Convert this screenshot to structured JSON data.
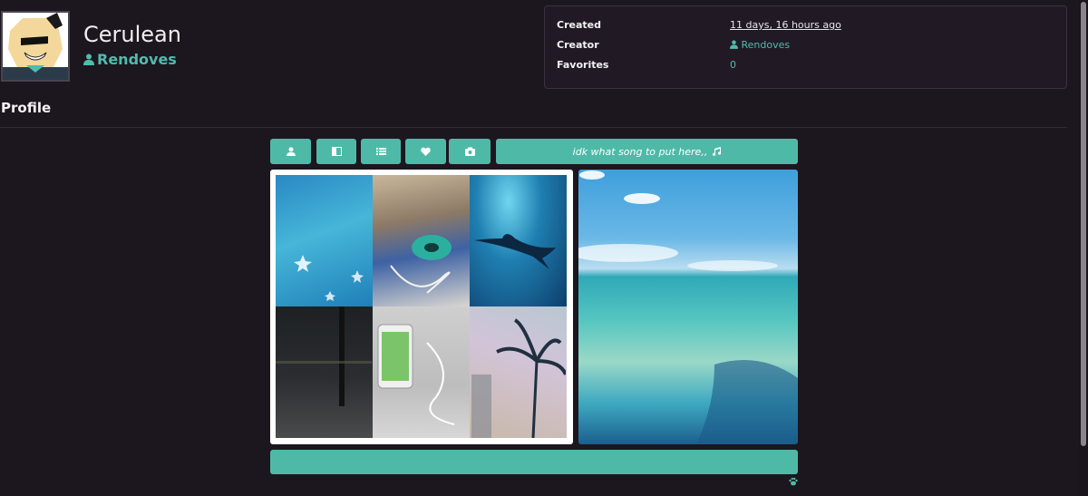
{
  "profile": {
    "name": "Cerulean",
    "creator": "Rendoves"
  },
  "info": [
    {
      "label": "Created",
      "value": "11 days, 16 hours ago"
    },
    {
      "label": "Creator",
      "value": "Rendoves"
    },
    {
      "label": "Favorites",
      "value": "0"
    }
  ],
  "section_title": "Profile",
  "tabs": {
    "icons": [
      "user-icon",
      "sidebar-icon",
      "list-icon",
      "heart-icon",
      "camera-icon"
    ],
    "song_label": "idk what song to put here,,"
  },
  "colors": {
    "accent": "#4fb9a8",
    "background": "#1c161e",
    "panel": "#211a24"
  }
}
